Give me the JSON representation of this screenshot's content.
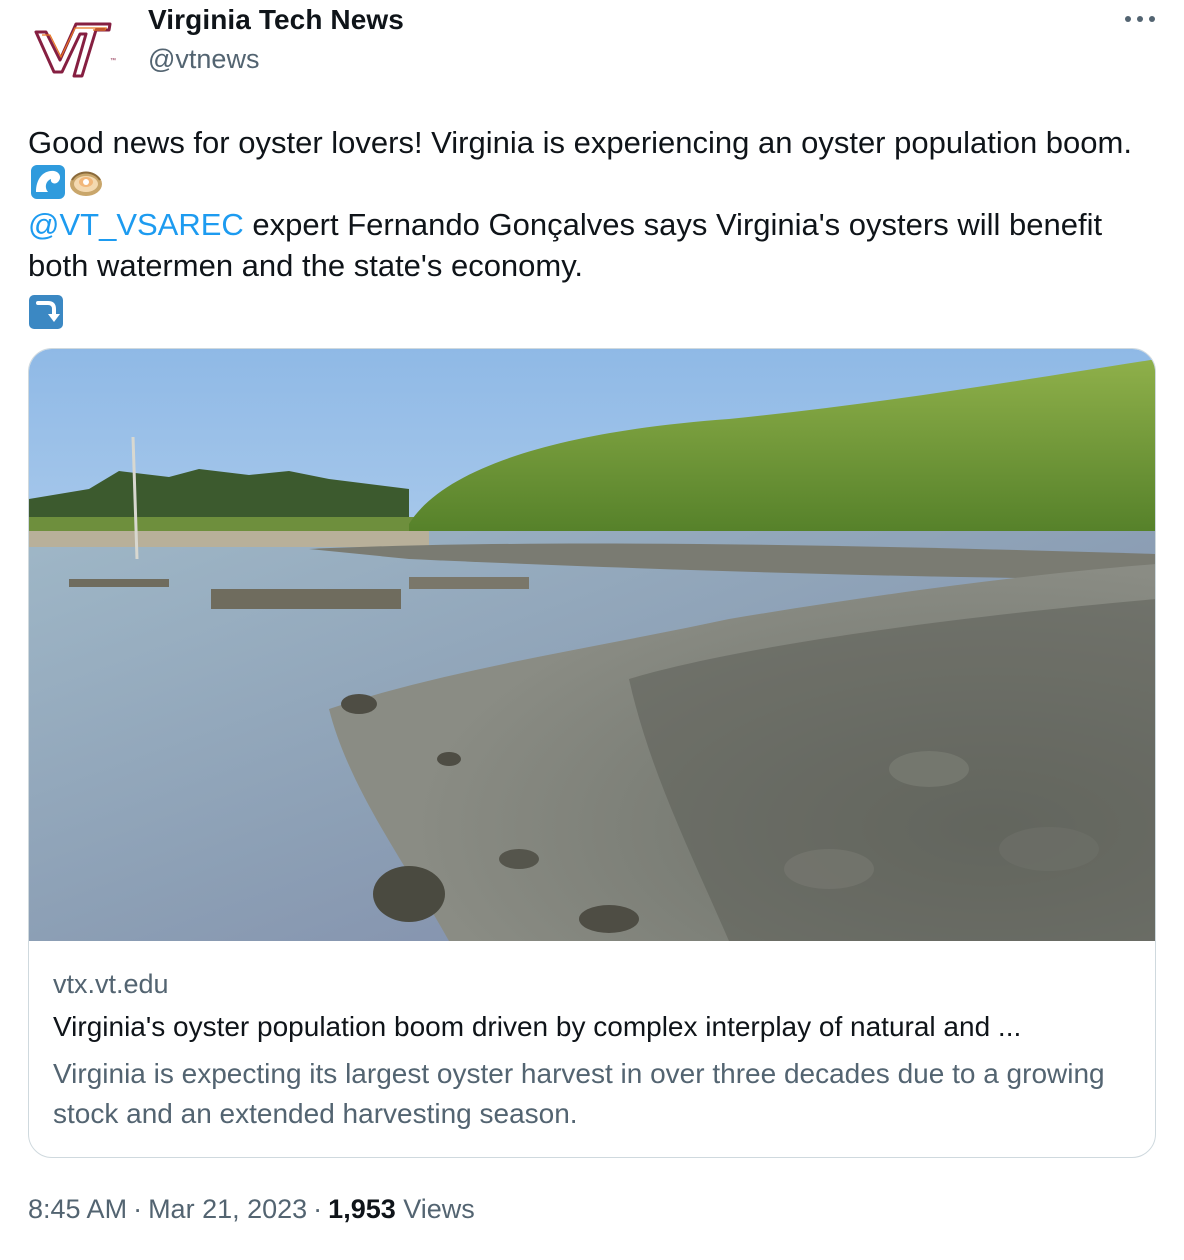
{
  "author": {
    "display_name": "Virginia Tech News",
    "handle": "@vtnews",
    "avatar_icon": "vt-logo-icon",
    "brand_color": "#861f41"
  },
  "more_icon": "more-options-icon",
  "tweet": {
    "line1_part1": "Good news for oyster lovers!  Virginia is experiencing an oyster population boom.",
    "emoji_wave": "wave-emoji-icon",
    "emoji_oyster": "oyster-emoji-icon",
    "mention": "@VT_VSAREC",
    "line2_rest": " expert Fernando Gonçalves says Virginia's oysters will benefit both watermen and the state's economy.",
    "emoji_arrow": "arrow-down-curving-icon"
  },
  "card": {
    "image_alt": "Oyster reef along a marsh shoreline",
    "domain": "vtx.vt.edu",
    "title": "Virginia's oyster population boom driven by complex interplay of natural and ...",
    "description": "Virginia is expecting its largest oyster harvest in over three decades due to a growing stock and an extended harvesting season."
  },
  "meta": {
    "time": "8:45 AM",
    "date": "Mar 21, 2023",
    "separator": "·",
    "views_count": "1,953",
    "views_label": "Views"
  },
  "colors": {
    "link": "#1d9bf0",
    "secondary_text": "#536471",
    "primary_text": "#0f1419",
    "border": "#cfd9de"
  }
}
